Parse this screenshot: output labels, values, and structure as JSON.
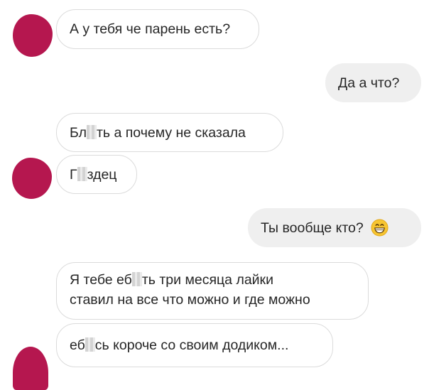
{
  "messages": {
    "m1": "А у тебя че парень есть?",
    "m2": "Да а что?",
    "m3": {
      "pre": "Бл",
      "post": "ть а почему не сказала"
    },
    "m4": {
      "pre": "Г",
      "post": "здец"
    },
    "m5": "Ты вообще кто?",
    "m6": {
      "line1_pre": "Я тебе еб",
      "line1_post": "ть три месяца лайки",
      "line2": "ставил на все что можно и где можно"
    },
    "m7": {
      "pre": "еб",
      "post": "сь короче со своим додиком..."
    }
  },
  "icons": {
    "avatar": "avatar-blurred",
    "emoji": "grinning-face-emoji"
  },
  "colors": {
    "avatar": "#b5174f",
    "incoming_border": "#dbdbdb",
    "outgoing_bg": "#efefef",
    "emoji_yellow": "#f7c531"
  }
}
